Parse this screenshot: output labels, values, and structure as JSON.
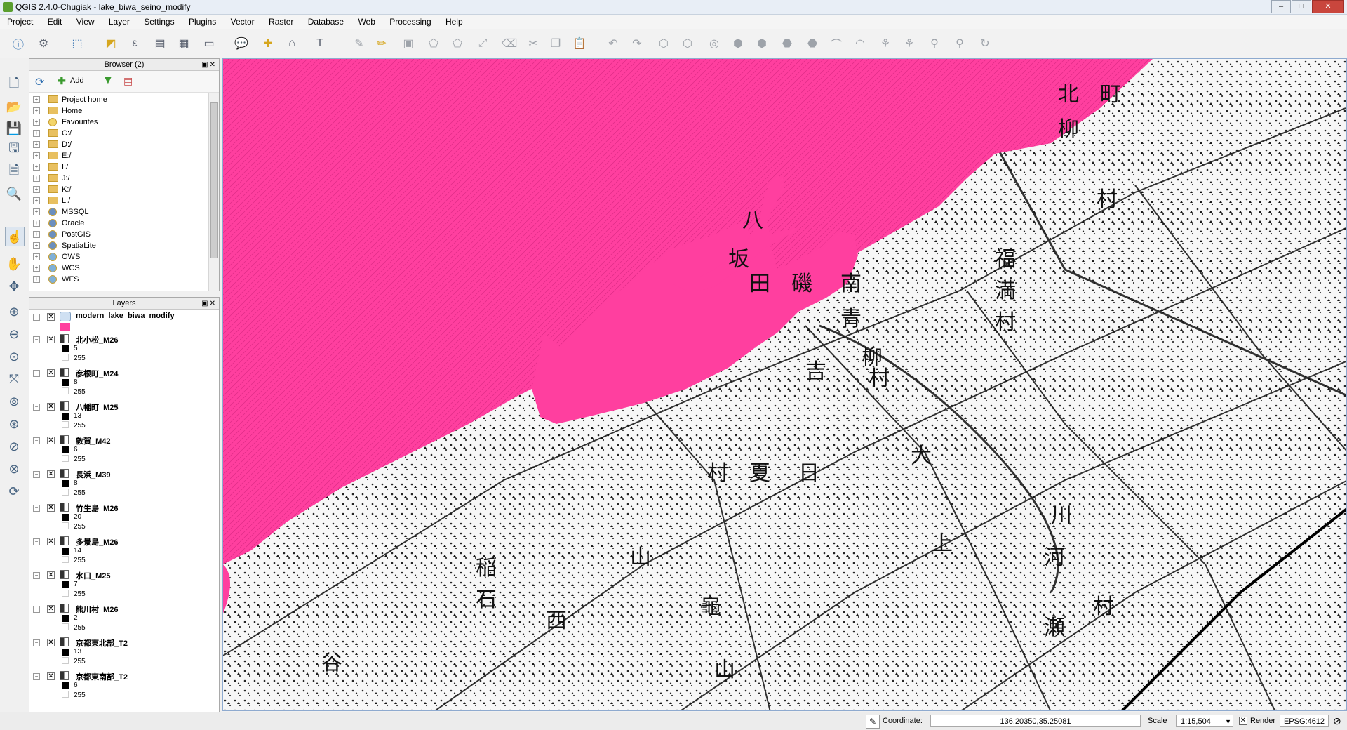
{
  "window": {
    "title": "QGIS 2.4.0-Chugiak - lake_biwa_seino_modify",
    "controls": [
      "–",
      "□",
      "✕"
    ]
  },
  "menu": [
    "Project",
    "Edit",
    "View",
    "Layer",
    "Settings",
    "Plugins",
    "Vector",
    "Raster",
    "Database",
    "Web",
    "Processing",
    "Help"
  ],
  "browser": {
    "title": "Browser (2)",
    "add_label": "Add",
    "items": [
      {
        "label": "Project home",
        "icon": "folder-icon"
      },
      {
        "label": "Home",
        "icon": "folder-icon"
      },
      {
        "label": "Favourites",
        "icon": "star-icon"
      },
      {
        "label": "C:/",
        "icon": "folder-icon"
      },
      {
        "label": "D:/",
        "icon": "folder-icon"
      },
      {
        "label": "E:/",
        "icon": "folder-icon"
      },
      {
        "label": "I:/",
        "icon": "folder-icon"
      },
      {
        "label": "J:/",
        "icon": "folder-icon"
      },
      {
        "label": "K:/",
        "icon": "folder-icon"
      },
      {
        "label": "L:/",
        "icon": "folder-icon"
      },
      {
        "label": "MSSQL",
        "icon": "database-icon"
      },
      {
        "label": "Oracle",
        "icon": "database-icon"
      },
      {
        "label": "PostGIS",
        "icon": "database-icon"
      },
      {
        "label": "SpatiaLite",
        "icon": "database-icon"
      },
      {
        "label": "OWS",
        "icon": "globe-icon"
      },
      {
        "label": "WCS",
        "icon": "globe-icon"
      },
      {
        "label": "WFS",
        "icon": "globe-icon"
      }
    ]
  },
  "layers": {
    "title": "Layers",
    "vector": {
      "name": "modern_lake_biwa_modify",
      "color": "#ff3f9f"
    },
    "rasters": [
      {
        "name": "北小松_M26",
        "min": "5",
        "max": "255"
      },
      {
        "name": "彦根町_M24",
        "min": "8",
        "max": "255"
      },
      {
        "name": "八幡町_M25",
        "min": "13",
        "max": "255"
      },
      {
        "name": "敦賀_M42",
        "min": "6",
        "max": "255"
      },
      {
        "name": "長浜_M39",
        "min": "8",
        "max": "255"
      },
      {
        "name": "竹生島_M26",
        "min": "20",
        "max": "255"
      },
      {
        "name": "多景島_M26",
        "min": "14",
        "max": "255"
      },
      {
        "name": "水口_M25",
        "min": "7",
        "max": "255"
      },
      {
        "name": "熊川村_M26",
        "min": "2",
        "max": "255"
      },
      {
        "name": "京都東北部_T2",
        "min": "13",
        "max": "255"
      },
      {
        "name": "京都東南部_T2",
        "min": "6",
        "max": "255"
      }
    ]
  },
  "map": {
    "labels": [
      "北",
      "町",
      "柳",
      "村",
      "八",
      "坂",
      "田",
      "磯",
      "南",
      "青",
      "柳",
      "福",
      "満",
      "村",
      "吉",
      "大",
      "村",
      "夏",
      "日",
      "村",
      "稲",
      "山",
      "上",
      "川",
      "河",
      "瀬",
      "龜",
      "山",
      "西",
      "石",
      "谷",
      "村"
    ],
    "lake_color": "#ff3f9f"
  },
  "status": {
    "coordinate_label": "Coordinate:",
    "coordinate_value": "136.20350,35.25081",
    "scale_label": "Scale",
    "scale_value": "1:15,504",
    "render_label": "Render",
    "epsg": "EPSG:4612"
  }
}
